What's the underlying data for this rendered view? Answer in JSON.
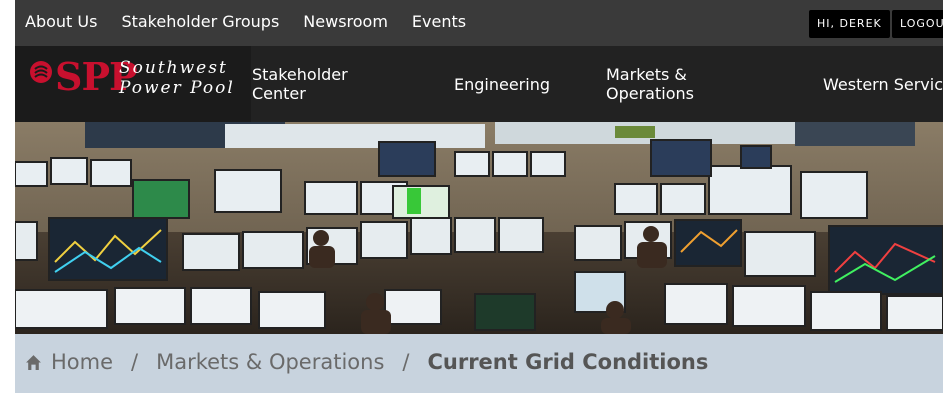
{
  "topbar": {
    "links": [
      "About Us",
      "Stakeholder Groups",
      "Newsroom",
      "Events"
    ],
    "user_greeting": "HI, DEREK",
    "logout": "LOGOUT"
  },
  "logo": {
    "mark": "SPP",
    "line1": "Southwest",
    "line2": "Power Pool"
  },
  "mainnav": {
    "items": [
      "Stakeholder Center",
      "Engineering",
      "Markets & Operations",
      "Western Services"
    ]
  },
  "breadcrumb": {
    "home": "Home",
    "separator": "/",
    "level1": "Markets & Operations",
    "current": "Current Grid Conditions"
  },
  "colors": {
    "brand_red": "#c8102e",
    "topbar_bg": "#3a3a3a",
    "header_bg": "#222222",
    "breadcrumb_bg": "#c8d3de"
  },
  "icons": {
    "logo_mark": "spp-logo-icon",
    "home": "home-icon"
  }
}
